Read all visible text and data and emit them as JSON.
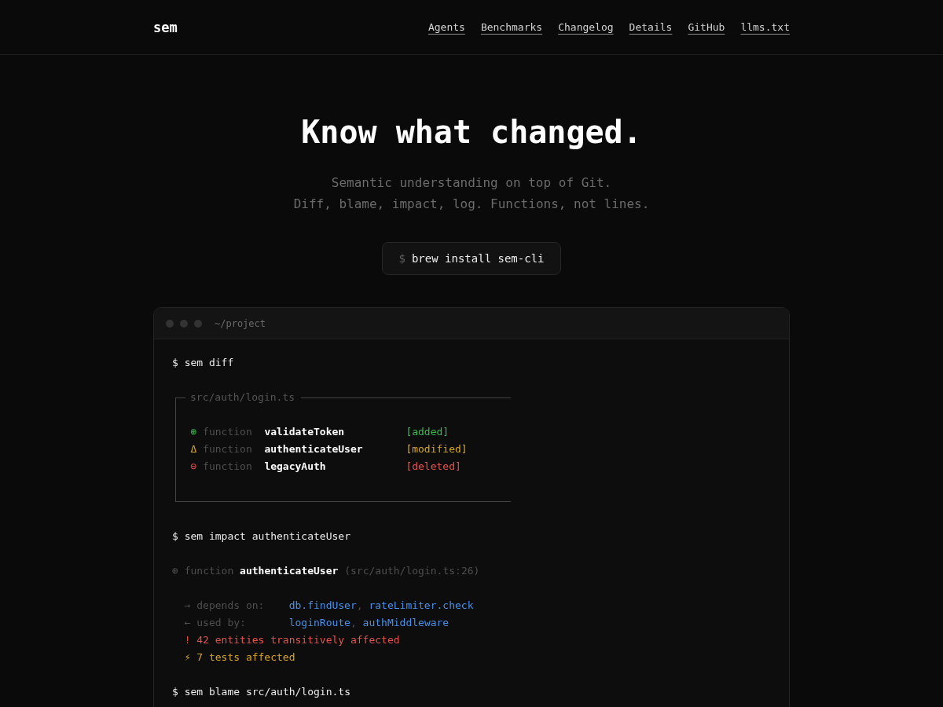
{
  "header": {
    "logo": "sem",
    "nav": [
      "Agents",
      "Benchmarks",
      "Changelog",
      "Details",
      "GitHub",
      "llms.txt"
    ]
  },
  "hero": {
    "title": "Know what changed.",
    "subtitle": [
      "Semantic understanding on top of Git.",
      "Diff, blame, impact, log. Functions, not lines."
    ],
    "install": {
      "prompt": "$",
      "command": "brew install sem-cli"
    }
  },
  "terminal": {
    "title": "~/project",
    "blocks": [
      {
        "kind": "command",
        "text": "$ sem diff"
      },
      {
        "kind": "diff",
        "file": "src/auth/login.ts",
        "entries": [
          {
            "kind": "added",
            "symbol": "⊕",
            "type": "function",
            "name": "validateToken",
            "status": "[added]"
          },
          {
            "kind": "modified",
            "symbol": "Δ",
            "type": "function",
            "name": "authenticateUser",
            "status": "[modified]"
          },
          {
            "kind": "deleted",
            "symbol": "⊖",
            "type": "function",
            "name": "legacyAuth",
            "status": "[deleted]"
          }
        ]
      },
      {
        "kind": "command",
        "text": "$ sem impact authenticateUser"
      },
      {
        "kind": "impact",
        "symbol": "⊕",
        "type": "function",
        "name": "authenticateUser",
        "location": "(src/auth/login.ts:26)",
        "relations": [
          {
            "arrow": "→",
            "label": "depends on:",
            "separator": ",",
            "targets": [
              "db.findUser",
              "rateLimiter.check"
            ]
          },
          {
            "arrow": "←",
            "label": "used by:",
            "separator": ",",
            "targets": [
              "loginRoute",
              "authMiddleware"
            ]
          }
        ],
        "alerts": [
          {
            "kind": "error",
            "symbol": "!",
            "text": "42 entities transitively affected"
          },
          {
            "kind": "warning",
            "symbol": "⚡",
            "text": "7 tests affected"
          }
        ]
      },
      {
        "kind": "command",
        "text": "$ sem blame src/auth/login.ts"
      }
    ]
  }
}
